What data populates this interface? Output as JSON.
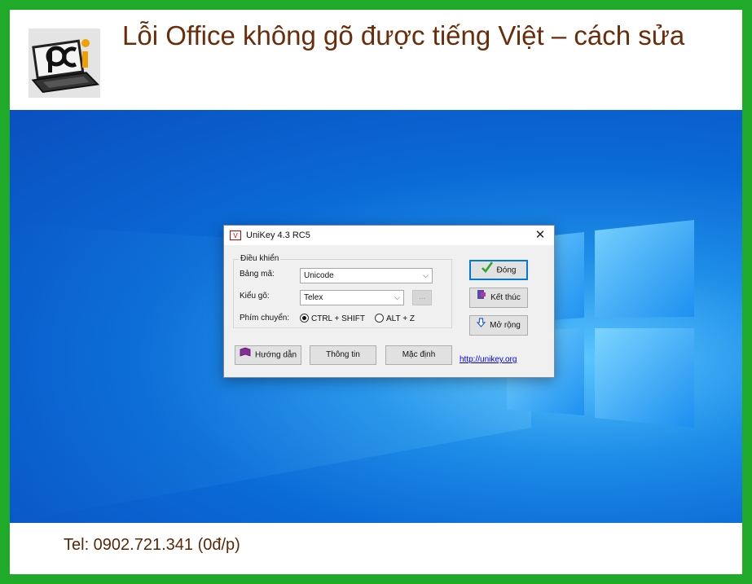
{
  "header": {
    "title": "Lỗi Office không gõ được tiếng Việt – cách sửa"
  },
  "footer": {
    "tel": "Tel: 0902.721.341 (0đ/p)"
  },
  "unikey": {
    "window_title": "UniKey 4.3 RC5",
    "close_glyph": "✕",
    "group_label": "Điều khiển",
    "bang_ma_label": "Bảng mã:",
    "bang_ma_value": "Unicode",
    "kieu_go_label": "Kiểu gõ:",
    "kieu_go_value": "Telex",
    "extra_button": "...",
    "phim_chuyen_label": "Phím chuyển:",
    "radio_ctrl_shift": "CTRL + SHIFT",
    "radio_alt_z": "ALT + Z",
    "selected_hotkey": "CTRL + SHIFT",
    "dong_button": "Đóng",
    "ket_thuc_button": "Kết thúc",
    "mo_rong_button": "Mở rộng",
    "huong_dan_button": "Hướng dẫn",
    "thong_tin_button": "Thông tin",
    "mac_dinh_button": "Mặc định",
    "link": "http://unikey.org"
  },
  "icons": {
    "check": "check-icon",
    "exit": "exit-icon",
    "expand": "arrow-down-icon",
    "book": "book-icon"
  },
  "colors": {
    "frame": "#1faa2a",
    "title": "#6b2c0a",
    "accent": "#0078d7"
  }
}
